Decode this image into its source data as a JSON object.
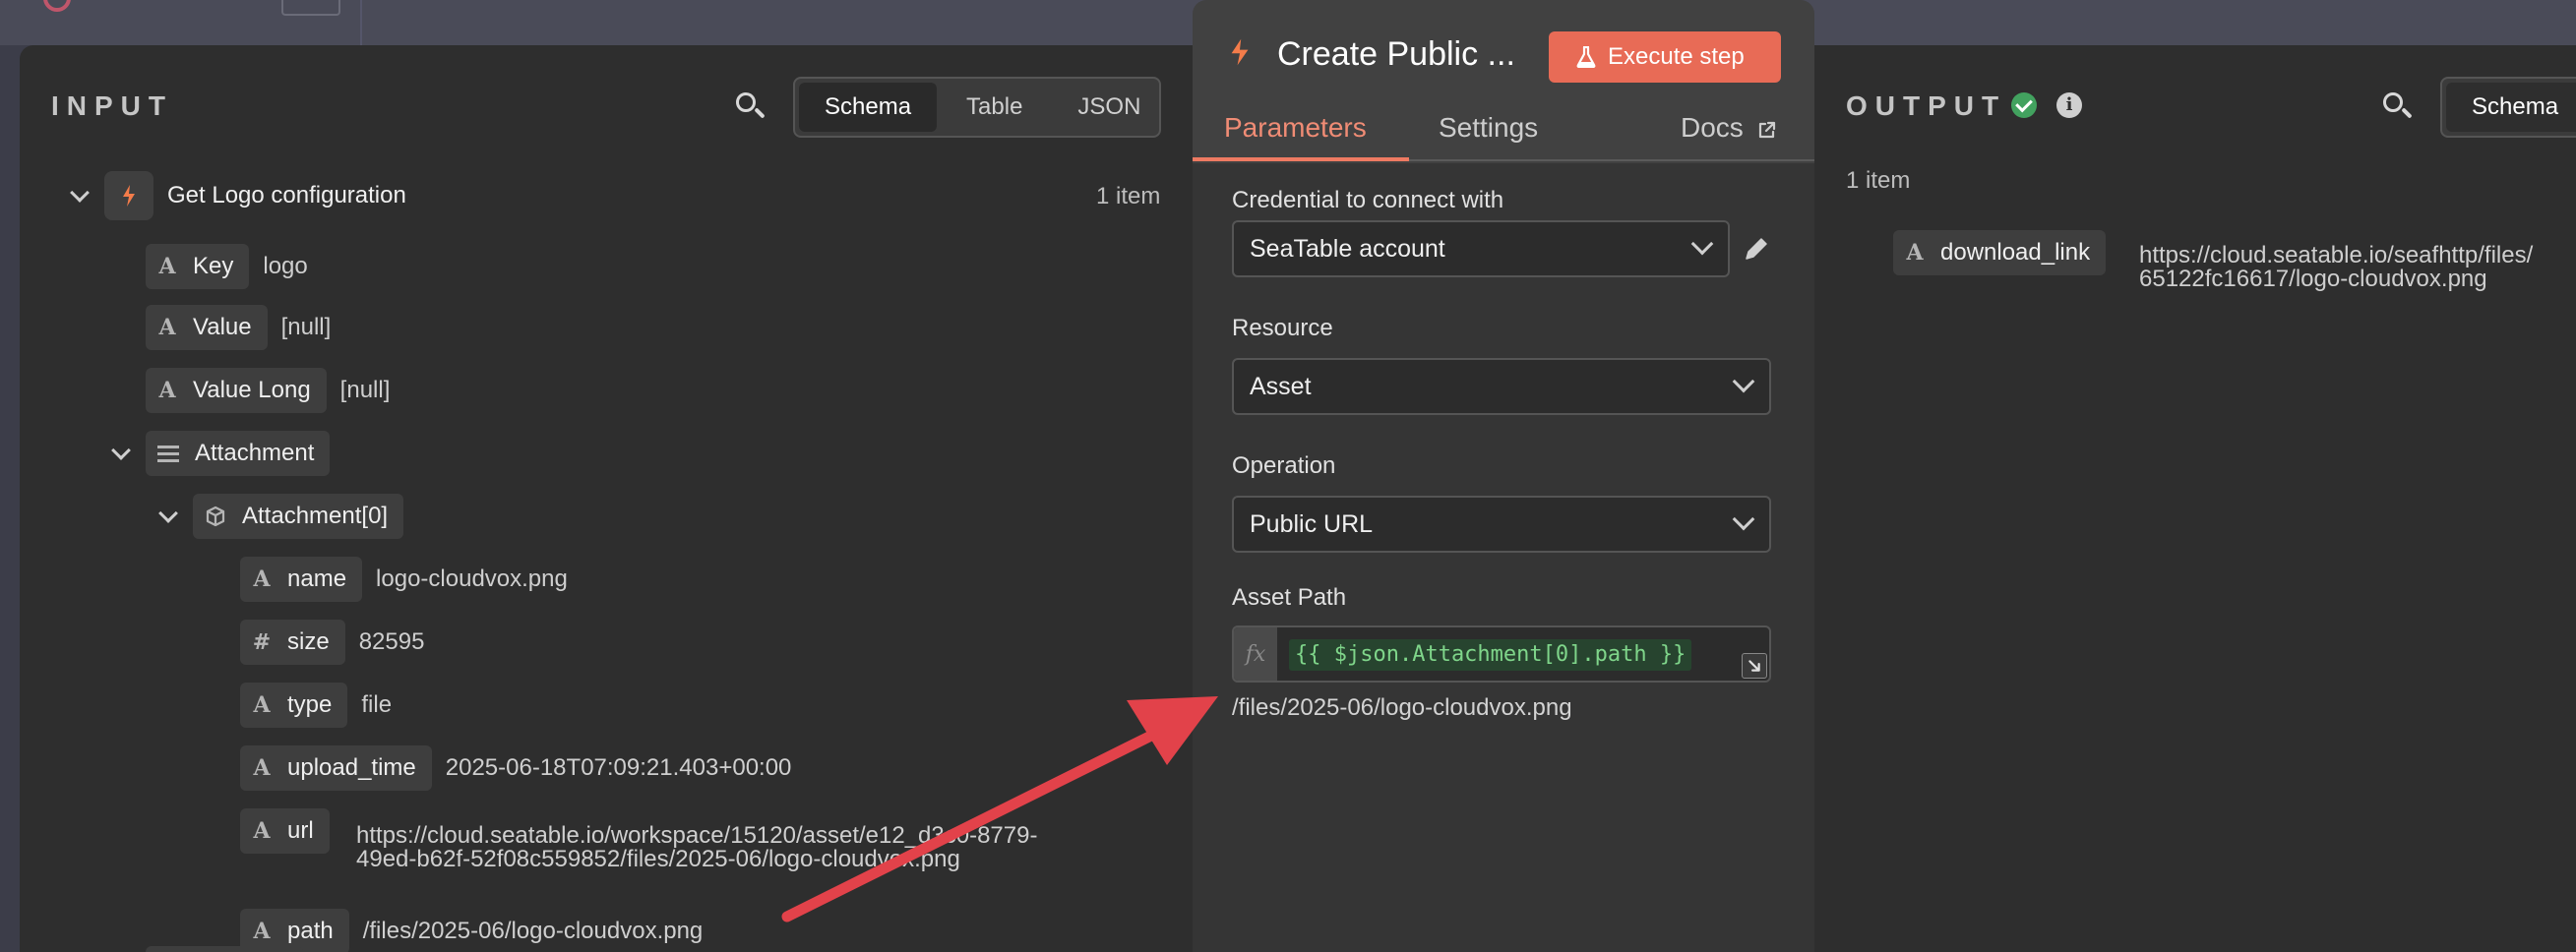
{
  "input": {
    "title": "INPUT",
    "views": [
      "Schema",
      "Table",
      "JSON"
    ],
    "active_view": "Schema",
    "node_name": "Get Logo configuration",
    "item_count": "1 item",
    "fields": [
      {
        "type": "A",
        "key": "Key",
        "value": "logo"
      },
      {
        "type": "A",
        "key": "Value",
        "value": "[null]"
      },
      {
        "type": "A",
        "key": "Value Long",
        "value": "[null]"
      },
      {
        "type": "list",
        "key": "Attachment",
        "value": ""
      },
      {
        "type": "object",
        "key": "Attachment[0]",
        "value": ""
      },
      {
        "type": "A",
        "key": "name",
        "value": "logo-cloudvox.png"
      },
      {
        "type": "#",
        "key": "size",
        "value": "82595"
      },
      {
        "type": "A",
        "key": "type",
        "value": "file"
      },
      {
        "type": "A",
        "key": "upload_time",
        "value": "2025-06-18T07:09:21.403+00:00"
      },
      {
        "type": "A",
        "key": "url",
        "value_line1": "https://cloud.seatable.io/workspace/15120/asset/e12_d3c0-8779-",
        "value_line2": "49ed-b62f-52f08c559852/files/2025-06/logo-cloudvox.png"
      },
      {
        "type": "A",
        "key": "path",
        "value": "/files/2025-06/logo-cloudvox.png"
      }
    ]
  },
  "node": {
    "title": "Create Public ...",
    "execute_label": "Execute step",
    "tabs": [
      "Parameters",
      "Settings",
      "Docs"
    ],
    "active_tab": "Parameters",
    "credential_label": "Credential to connect with",
    "credential_value": "SeaTable account",
    "resource_label": "Resource",
    "resource_value": "Asset",
    "operation_label": "Operation",
    "operation_value": "Public URL",
    "asset_path_label": "Asset Path",
    "fx": "fx",
    "asset_path_expression": "{{ $json.Attachment[0].path }}",
    "asset_path_result": "/files/2025-06/logo-cloudvox.png"
  },
  "output": {
    "title": "OUTPUT",
    "item_count": "1 item",
    "view": "Schema",
    "field_type": "A",
    "field_key": "download_link",
    "value_line1": "https://cloud.seatable.io/seafhttp/files/",
    "value_line2": "65122fc16617/logo-cloudvox.png"
  },
  "colors": {
    "accent": "#e86b56",
    "tab_active": "#f08c75",
    "success": "#42a25f",
    "annotation_arrow": "#e2424a"
  }
}
